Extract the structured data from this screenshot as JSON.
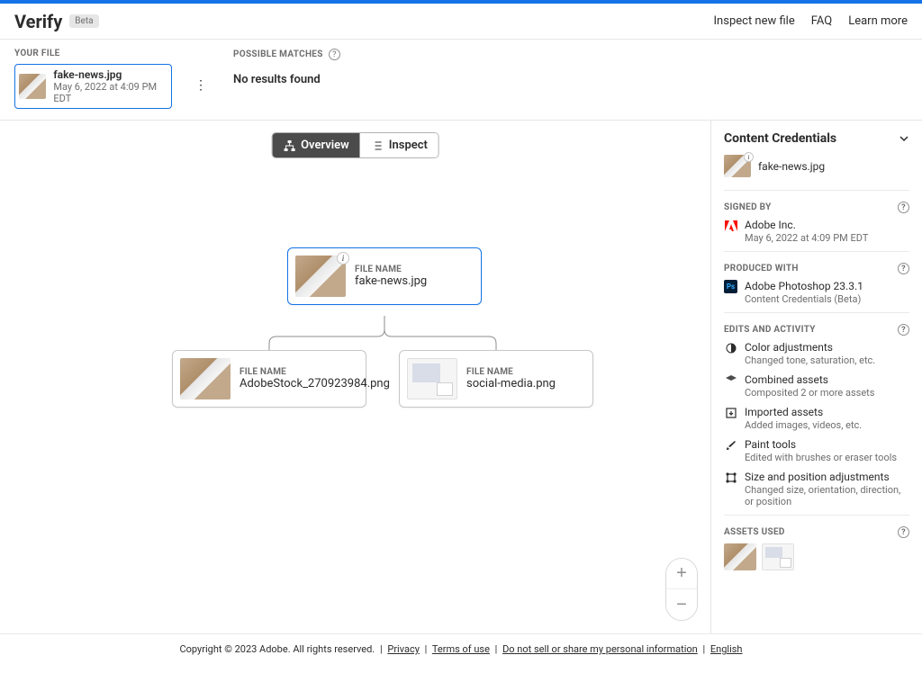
{
  "header": {
    "title": "Verify",
    "badge": "Beta",
    "nav": {
      "inspect": "Inspect new file",
      "faq": "FAQ",
      "learn": "Learn more"
    }
  },
  "filebar": {
    "your_file_label": "YOUR FILE",
    "file_name": "fake-news.jpg",
    "file_date": "May 6, 2022 at 4:09 PM EDT",
    "matches_label": "POSSIBLE MATCHES",
    "no_results": "No results found"
  },
  "mode": {
    "overview": "Overview",
    "inspect": "Inspect"
  },
  "graph": {
    "root": {
      "label": "FILE NAME",
      "name": "fake-news.jpg"
    },
    "child1": {
      "label": "FILE NAME",
      "name": "AdobeStock_270923984.png"
    },
    "child2": {
      "label": "FILE NAME",
      "name": "social-media.png"
    }
  },
  "sidebar": {
    "panel_title": "Content Credentials",
    "file_name": "fake-news.jpg",
    "signed_label": "SIGNED BY",
    "signed_name": "Adobe Inc.",
    "signed_date": "May 6, 2022 at 4:09 PM EDT",
    "produced_label": "PRODUCED WITH",
    "produced_app": "Adobe Photoshop 23.3.1",
    "produced_sub": "Content Credentials (Beta)",
    "edits_label": "EDITS AND ACTIVITY",
    "edits": [
      {
        "title": "Color adjustments",
        "sub": "Changed tone, saturation, etc."
      },
      {
        "title": "Combined assets",
        "sub": "Composited 2 or more assets"
      },
      {
        "title": "Imported assets",
        "sub": "Added images, videos, etc."
      },
      {
        "title": "Paint tools",
        "sub": "Edited with brushes or eraser tools"
      },
      {
        "title": "Size and position adjustments",
        "sub": "Changed size, orientation, direction, or position"
      }
    ],
    "assets_label": "ASSETS USED"
  },
  "footer": {
    "copy": "Copyright © 2023 Adobe. All rights reserved.",
    "privacy": "Privacy",
    "terms": "Terms of use",
    "dnsmpi": "Do not sell or share my personal information",
    "english": "English"
  }
}
